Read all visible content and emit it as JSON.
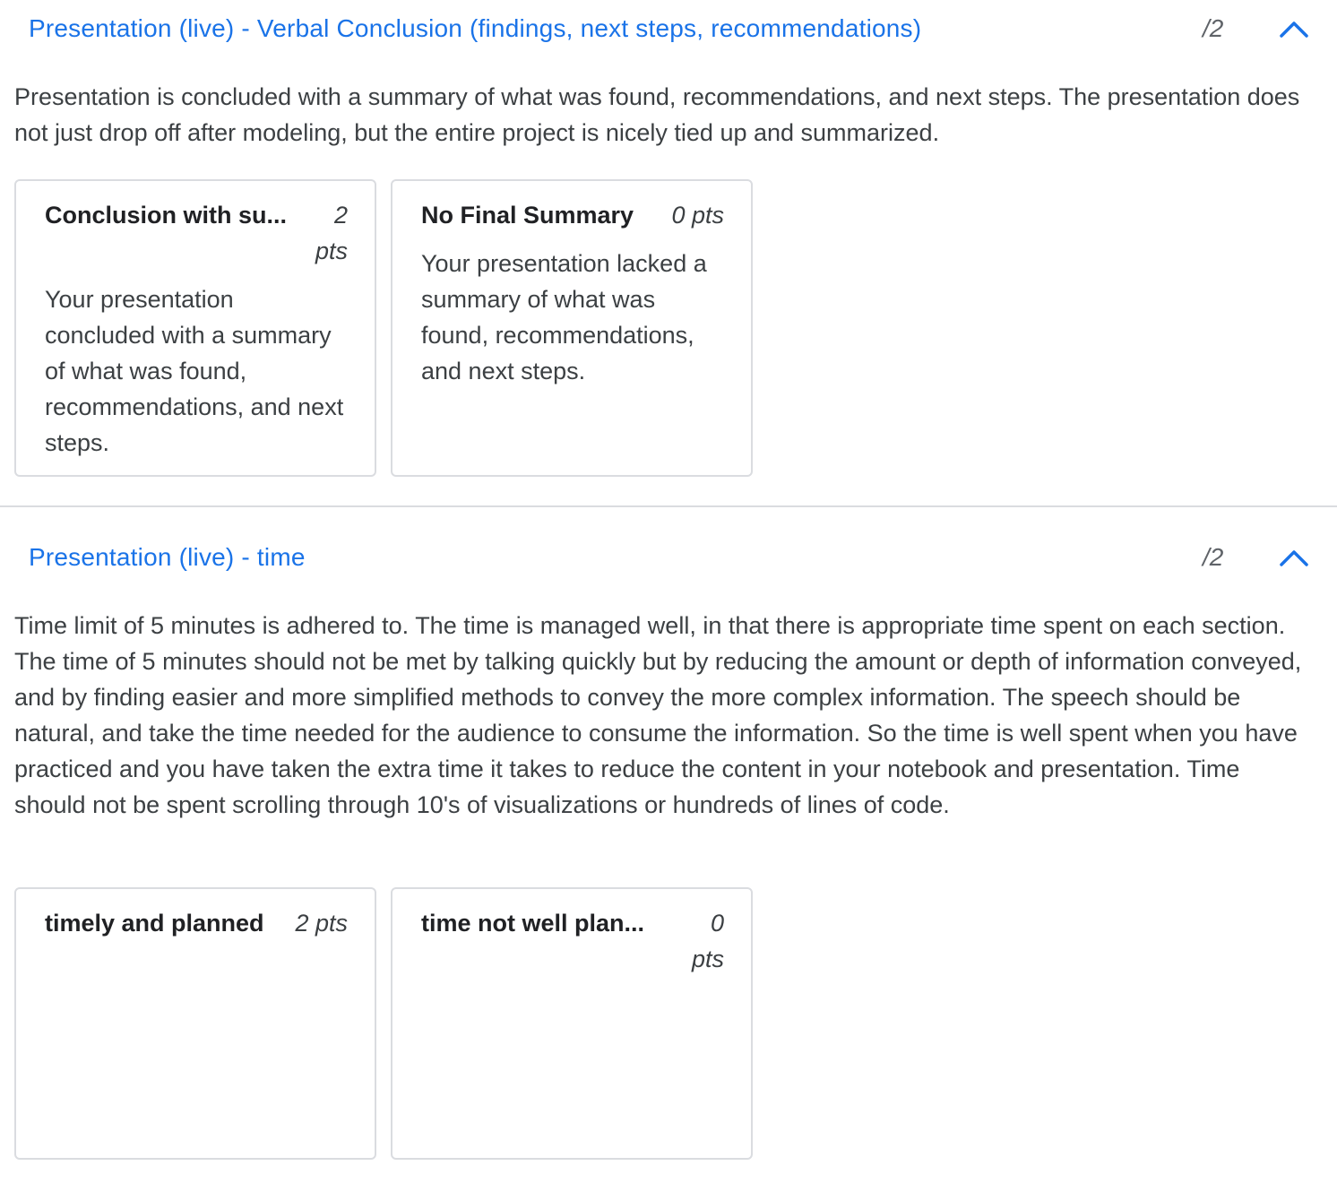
{
  "criteria": [
    {
      "title": "Presentation (live) - Verbal Conclusion (findings, next steps, recommendations)",
      "score": "/2",
      "collapse_icon": "chevron-up-icon",
      "description": "Presentation is concluded with a summary of what was found, recommendations, and next steps. The presentation does not just drop off after modeling, but the entire project is nicely tied up and summarized.",
      "ratings": [
        {
          "title": "Conclusion with su...",
          "points": "2",
          "points_unit": "pts",
          "description": "Your presentation concluded with a summary of what was found, recommendations, and next steps."
        },
        {
          "title": "No Final Summary",
          "points": "0 pts",
          "points_unit": "",
          "description": "Your presentation lacked a summary of what was found, recommendations, and next steps."
        }
      ]
    },
    {
      "title": "Presentation (live) - time",
      "score": "/2",
      "collapse_icon": "chevron-up-icon",
      "description": "Time limit of 5 minutes is adhered to. The time is managed well, in that there is appropriate time spent on each section. The time of 5 minutes should not be met by talking quickly but by reducing the amount or depth of information conveyed, and by finding easier and more simplified methods to convey the more complex information. The speech should be natural, and take the time needed for the audience to consume the information. So the time is well spent when you have practiced and you have taken the extra time it takes to reduce the content in your notebook and presentation. Time should not be spent scrolling through 10's of visualizations or hundreds of lines of code.",
      "ratings": [
        {
          "title": "timely and planned",
          "points": "2 pts",
          "points_unit": "",
          "description": ""
        },
        {
          "title": "time not well plan...",
          "points": "0",
          "points_unit": "pts",
          "description": ""
        }
      ]
    }
  ],
  "colors": {
    "link": "#1a73e8",
    "border": "#dadce0",
    "text": "#3c4043"
  }
}
